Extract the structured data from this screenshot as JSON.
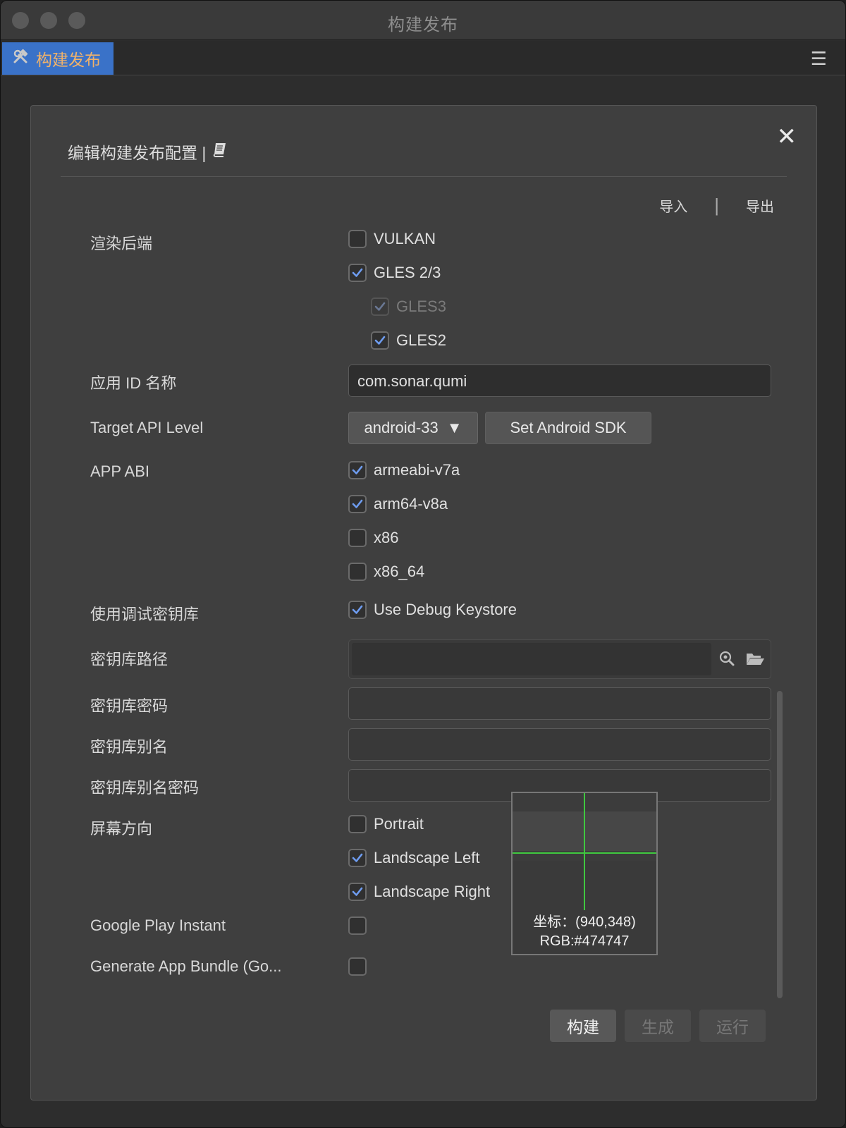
{
  "window": {
    "title": "构建发布"
  },
  "tab": {
    "label": "构建发布",
    "icon": "hammer-wrench-icon"
  },
  "panel": {
    "title": "编辑构建发布配置 |",
    "import_label": "导入",
    "separator": "|",
    "export_label": "导出"
  },
  "render_backend": {
    "label": "渲染后端",
    "options": [
      {
        "label": "VULKAN",
        "checked": false,
        "disabled": false
      },
      {
        "label": "GLES 2/3",
        "checked": true,
        "disabled": false
      },
      {
        "label": "GLES3",
        "checked": true,
        "disabled": true
      },
      {
        "label": "GLES2",
        "checked": true,
        "disabled": false
      }
    ]
  },
  "app_id": {
    "label": "应用 ID 名称",
    "value": "com.sonar.qumi"
  },
  "target_api": {
    "label": "Target API Level",
    "selected": "android-33",
    "sdk_button": "Set Android SDK"
  },
  "app_abi": {
    "label": "APP ABI",
    "options": [
      {
        "label": "armeabi-v7a",
        "checked": true
      },
      {
        "label": "arm64-v8a",
        "checked": true
      },
      {
        "label": "x86",
        "checked": false
      },
      {
        "label": "x86_64",
        "checked": false
      }
    ]
  },
  "debug_keystore": {
    "label": "使用调试密钥库",
    "option": "Use Debug Keystore",
    "checked": true
  },
  "keystore_path": {
    "label": "密钥库路径",
    "value": ""
  },
  "keystore_password": {
    "label": "密钥库密码",
    "value": ""
  },
  "keystore_alias": {
    "label": "密钥库别名",
    "value": ""
  },
  "keystore_alias_password": {
    "label": "密钥库别名密码",
    "value": ""
  },
  "orientation": {
    "label": "屏幕方向",
    "options": [
      {
        "label": "Portrait",
        "checked": false
      },
      {
        "label": "Landscape Left",
        "checked": true
      },
      {
        "label": "Landscape Right",
        "checked": true
      }
    ]
  },
  "google_play_instant": {
    "label": "Google Play Instant",
    "checked": false
  },
  "app_bundle": {
    "label": "Generate App Bundle (Go...",
    "checked": false
  },
  "actions": {
    "build": "构建",
    "generate": "生成",
    "run": "运行"
  },
  "magnifier": {
    "coords": "坐标：(940,348)",
    "rgb": "RGB:#474747"
  },
  "colors": {
    "accent": "#3a72c8",
    "tab_text": "#f0b26a",
    "check": "#6e9cf0",
    "crosshair": "#3fc83f"
  }
}
